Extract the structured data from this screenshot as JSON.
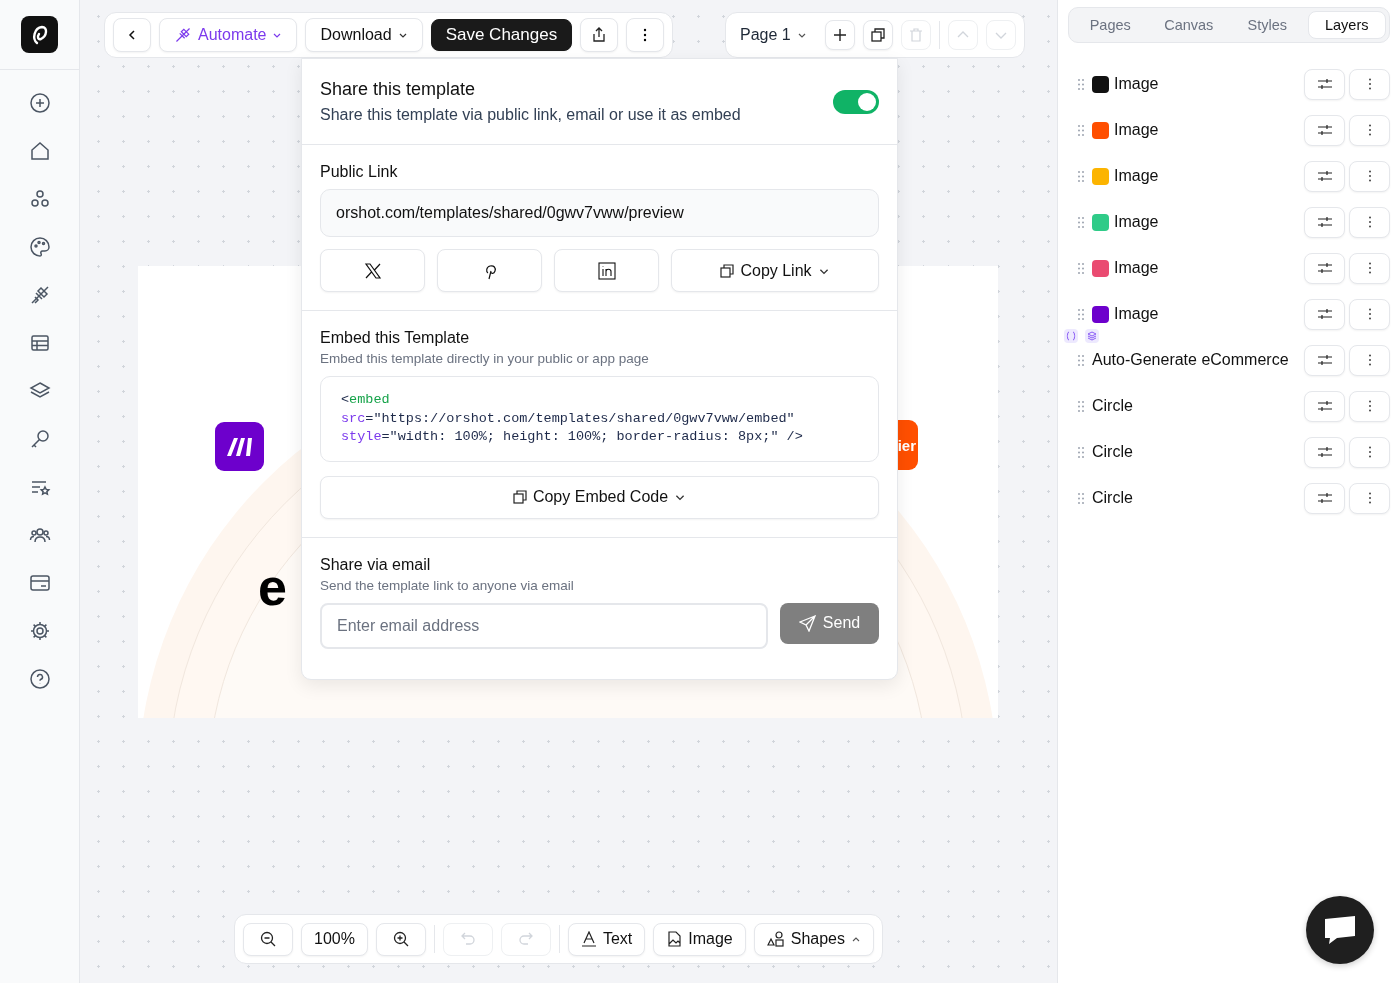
{
  "toolbar": {
    "automate": "Automate",
    "download": "Download",
    "save": "Save Changes"
  },
  "page_toolbar": {
    "page": "Page 1",
    "delete_disabled": true,
    "move_up_disabled": true,
    "move_down_disabled": true
  },
  "artboard": {
    "heading_fragment": "e",
    "badge_fragment": "ier"
  },
  "share": {
    "title": "Share this template",
    "subtitle": "Share this template via public link, email or use it as embed",
    "enabled": true,
    "public_link": {
      "label": "Public Link",
      "url": "orshot.com/templates/shared/0gwv7vww/preview",
      "copy": "Copy Link"
    },
    "embed": {
      "title": "Embed this Template",
      "subtitle": "Embed this template directly in your public or app page",
      "copy": "Copy Embed Code",
      "code_lines": [
        [
          {
            "kind": "punct",
            "text": "<"
          },
          {
            "kind": "tag",
            "text": "embed"
          }
        ],
        [
          {
            "kind": "attr",
            "text": "src"
          },
          {
            "kind": "punct",
            "text": "=\"https://orshot.com/templates/shared/0gwv7vww/embed\""
          }
        ],
        [
          {
            "kind": "attr",
            "text": "style"
          },
          {
            "kind": "punct",
            "text": "=\"width: 100%; height: 100%; border-radius: 8px;\" />"
          }
        ]
      ]
    },
    "email": {
      "title": "Share via email",
      "subtitle": "Send the template link to anyone via email",
      "placeholder": "Enter email address",
      "send": "Send",
      "send_disabled": true
    }
  },
  "panel_tabs": [
    {
      "label": "Pages",
      "selected": false
    },
    {
      "label": "Canvas",
      "selected": false
    },
    {
      "label": "Styles",
      "selected": false
    },
    {
      "label": "Layers",
      "selected": true
    }
  ],
  "layers": [
    {
      "kind": "image",
      "name": "Image",
      "color": "#111111"
    },
    {
      "kind": "image",
      "name": "Image",
      "color": "#ff4f00"
    },
    {
      "kind": "image",
      "name": "Image",
      "color": "#fcb400"
    },
    {
      "kind": "image",
      "name": "Image",
      "color": "#2fcb88"
    },
    {
      "kind": "image",
      "name": "Image",
      "color": "#ea4b71"
    },
    {
      "kind": "image",
      "name": "Image",
      "color": "#6d00cc"
    },
    {
      "kind": "group",
      "name": "Auto-Generate eCommerce"
    },
    {
      "kind": "shape",
      "name": "Circle"
    },
    {
      "kind": "shape",
      "name": "Circle"
    },
    {
      "kind": "shape",
      "name": "Circle"
    }
  ],
  "bottom_toolbar": {
    "zoom": "100%",
    "undo_disabled": true,
    "redo_disabled": true,
    "text": "Text",
    "image": "Image",
    "shapes": "Shapes"
  }
}
